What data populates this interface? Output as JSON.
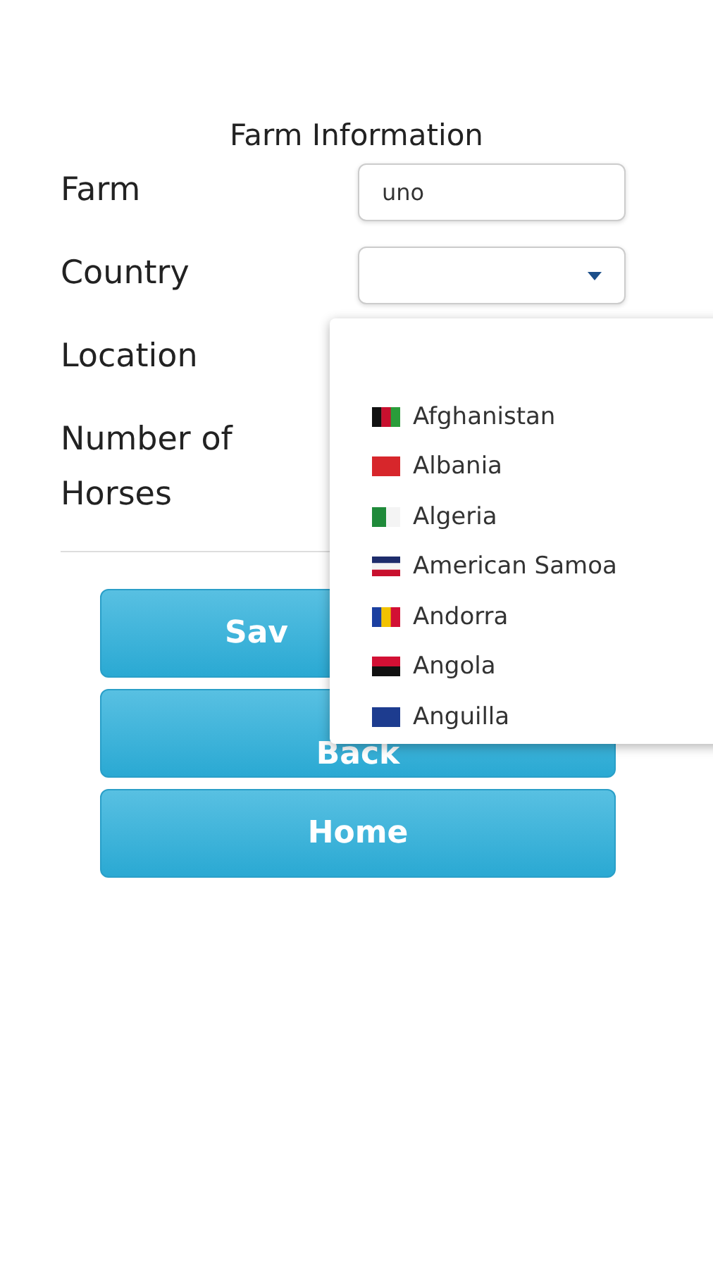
{
  "form": {
    "title": "Farm Information",
    "fields": [
      {
        "label": "Farm",
        "kind": "text",
        "value": "uno"
      },
      {
        "label": "Country",
        "kind": "select"
      },
      {
        "label": "Location",
        "kind": "hidden"
      },
      {
        "label": "Number of Horses",
        "kind": "hidden"
      }
    ]
  },
  "buttons": [
    {
      "label": "Sav",
      "kind": "cut-right"
    },
    {
      "label": "Back",
      "kind": "cut-top"
    },
    {
      "label": "Home",
      "kind": "plain"
    }
  ],
  "dropdown": {
    "open": true,
    "options": [
      {
        "label": "Afghanistan"
      },
      {
        "label": "Albania"
      },
      {
        "label": "Algeria"
      },
      {
        "label": "American Samoa"
      },
      {
        "label": "Andorra"
      },
      {
        "label": "Angola"
      },
      {
        "label": "Anguilla"
      }
    ]
  }
}
